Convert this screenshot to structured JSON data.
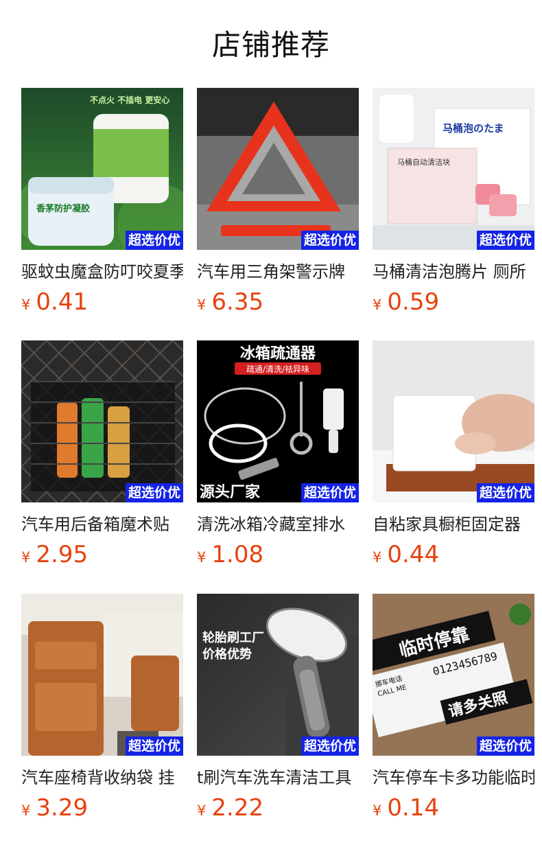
{
  "page": {
    "title": "店铺推荐"
  },
  "badge_label": "超选价优",
  "currency": "¥",
  "products": [
    {
      "name": "驱蚊虫魔盒防叮咬夏季",
      "price": "0.41",
      "image_text": [
        "不点火 不插电 更安心",
        "香茅防护凝胶"
      ]
    },
    {
      "name": "汽车用三角架警示牌",
      "price": "6.35",
      "image_text": []
    },
    {
      "name": "马桶清洁泡腾片 厕所",
      "price": "0.59",
      "image_text": [
        "马桶泡のたま",
        "马桶自动清洁块"
      ]
    },
    {
      "name": "汽车用后备箱魔术贴",
      "price": "2.95",
      "image_text": []
    },
    {
      "name": "清洗冰箱冷藏室排水",
      "price": "1.08",
      "image_text": [
        "冰箱疏通器",
        "疏通/清洗/祛异味",
        "源头厂家"
      ]
    },
    {
      "name": "自粘家具橱柜固定器",
      "price": "0.44",
      "image_text": []
    },
    {
      "name": "汽车座椅背收纳袋 挂",
      "price": "3.29",
      "image_text": []
    },
    {
      "name": "t刷汽车洗车清洁工具",
      "price": "2.22",
      "image_text": [
        "轮胎刷工厂",
        "价格优势"
      ]
    },
    {
      "name": "汽车停车卡多功能临时",
      "price": "0.14",
      "image_text": [
        "临时停靠",
        "请多关照",
        "挪车电话",
        "CALL ME",
        "0123456789"
      ]
    }
  ]
}
